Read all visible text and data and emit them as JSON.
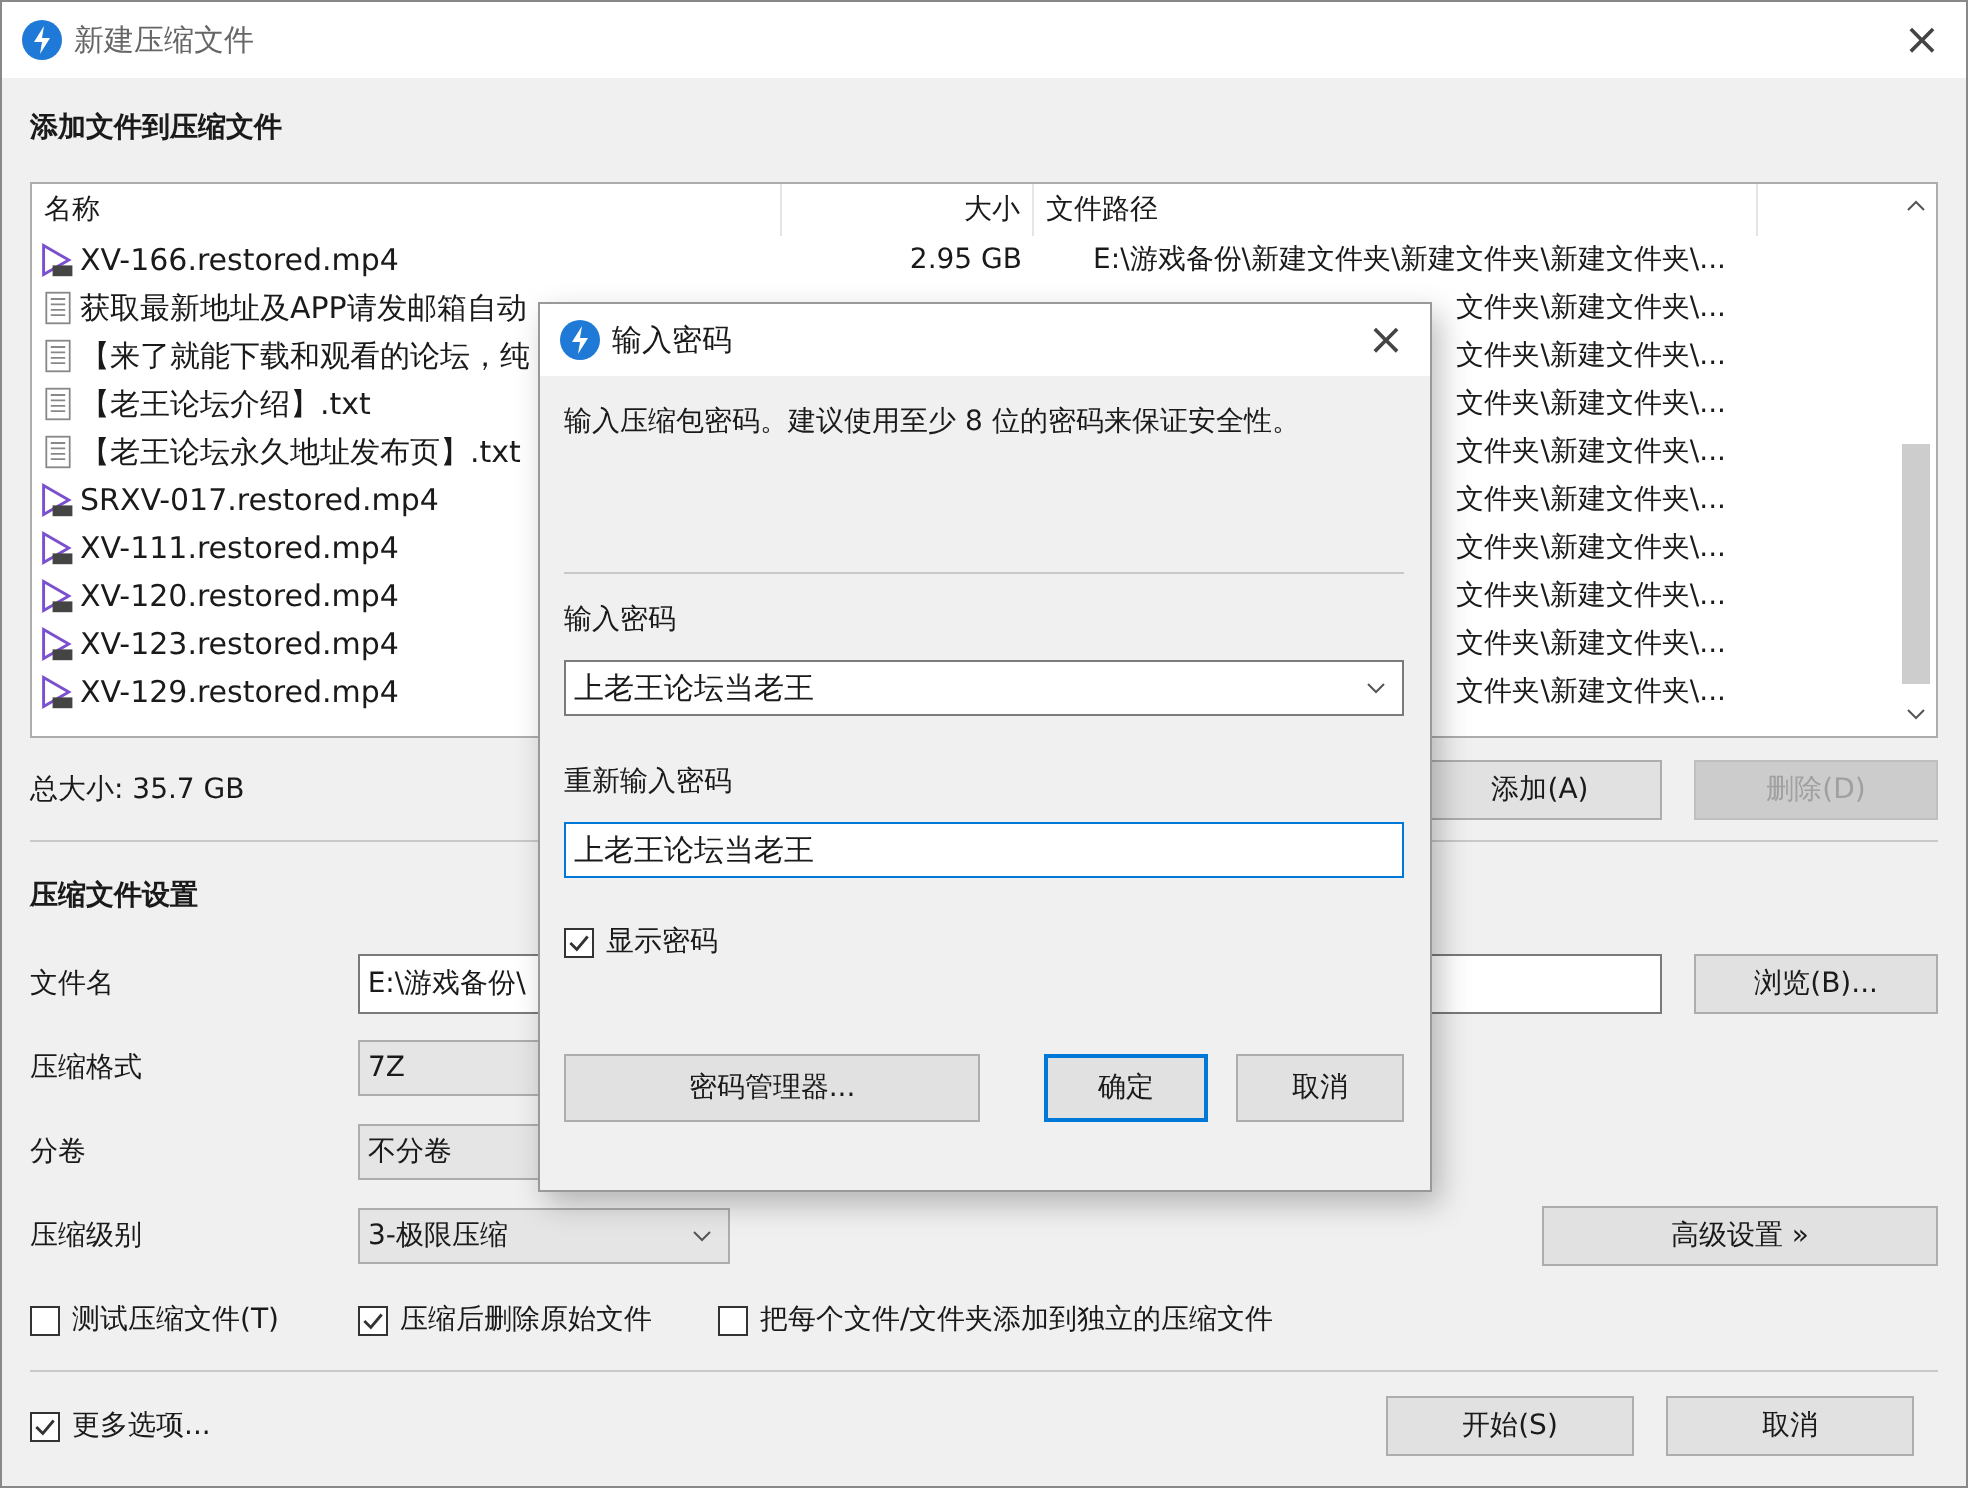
{
  "window": {
    "title": "新建压缩文件",
    "close": "×"
  },
  "files_section": {
    "heading": "添加文件到压缩文件",
    "columns": [
      {
        "label": "名称"
      },
      {
        "label": "大小"
      },
      {
        "label": "文件路径"
      }
    ],
    "rows": [
      {
        "kind": "video",
        "name": "XV-166.restored.mp4",
        "size": "2.95 GB",
        "path": "E:\\游戏备份\\新建文件夹\\新建文件夹\\新建文件夹\\..."
      },
      {
        "kind": "text",
        "name": "获取最新地址及APP请发邮箱自动",
        "path": "文件夹\\新建文件夹\\..."
      },
      {
        "kind": "text",
        "name": "【来了就能下载和观看的论坛，纯",
        "path": "文件夹\\新建文件夹\\..."
      },
      {
        "kind": "text",
        "name": "【老王论坛介绍】.txt",
        "path": "文件夹\\新建文件夹\\..."
      },
      {
        "kind": "text",
        "name": "【老王论坛永久地址发布页】.txt",
        "path": "文件夹\\新建文件夹\\..."
      },
      {
        "kind": "video",
        "name": "SRXV-017.restored.mp4",
        "path": "文件夹\\新建文件夹\\..."
      },
      {
        "kind": "video",
        "name": "XV-111.restored.mp4",
        "path": "文件夹\\新建文件夹\\..."
      },
      {
        "kind": "video",
        "name": "XV-120.restored.mp4",
        "path": "文件夹\\新建文件夹\\..."
      },
      {
        "kind": "video",
        "name": "XV-123.restored.mp4",
        "path": "文件夹\\新建文件夹\\..."
      },
      {
        "kind": "video",
        "name": "XV-129.restored.mp4",
        "path": "文件夹\\新建文件夹\\..."
      }
    ],
    "total": "总大小: 35.7 GB",
    "buttons": [
      {
        "label": "添加(A)",
        "disabled": false
      },
      {
        "label": "删除(D)",
        "disabled": true
      }
    ]
  },
  "settings": {
    "heading": "压缩文件设置",
    "filename": {
      "label": "文件名",
      "value": "E:\\游戏备份\\"
    },
    "browse": "浏览(B)...",
    "format": {
      "label": "压缩格式",
      "value": "7Z"
    },
    "volume": {
      "label": "分卷",
      "value": "不分卷"
    },
    "level": {
      "label": "压缩级别",
      "value": "3-极限压缩"
    },
    "advanced": "高级设置 »",
    "options": [
      {
        "label": "测试压缩文件(T)",
        "checked": false
      },
      {
        "label": "压缩后删除原始文件",
        "checked": true
      },
      {
        "label": "把每个文件/文件夹添加到独立的压缩文件",
        "checked": false
      }
    ]
  },
  "footer": {
    "more": {
      "label": "更多选项...",
      "checked": true
    },
    "buttons": [
      "开始(S)",
      "取消"
    ]
  },
  "dialog": {
    "title": "输入密码",
    "close": "×",
    "description": "输入压缩包密码。建议使用至少 8 位的密码来保证安全性。",
    "password_label": "输入密码",
    "password": "上老王论坛当老王",
    "confirm_label": "重新输入密码",
    "confirm": "上老王论坛当老王",
    "show_password": {
      "label": "显示密码",
      "checked": true
    },
    "manager": "密码管理器...",
    "buttons": [
      {
        "label": "确定",
        "selected": true
      },
      {
        "label": "取消",
        "selected": false
      }
    ]
  }
}
